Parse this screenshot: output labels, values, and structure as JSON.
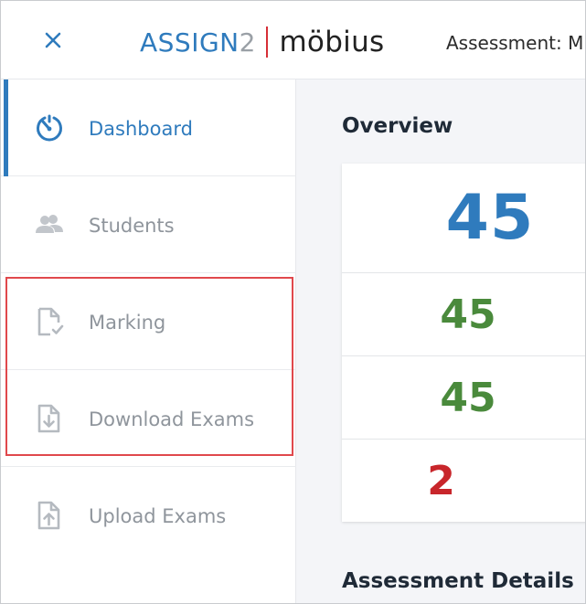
{
  "header": {
    "logo_assign": "ASSIGN",
    "logo_two": "2",
    "logo_mobius": "möbius",
    "assessment_label": "Assessment: M"
  },
  "sidebar": {
    "items": [
      {
        "label": "Dashboard",
        "icon": "timer-icon",
        "active": true
      },
      {
        "label": "Students",
        "icon": "people-icon",
        "active": false
      },
      {
        "label": "Marking",
        "icon": "file-check-icon",
        "active": false
      },
      {
        "label": "Download Exams",
        "icon": "file-download-icon",
        "active": false
      },
      {
        "label": "Upload Exams",
        "icon": "file-upload-icon",
        "active": false
      }
    ]
  },
  "main": {
    "overview_title": "Overview",
    "stats": [
      "45",
      "45",
      "45",
      "2"
    ],
    "details_title": "Assessment Details"
  },
  "colors": {
    "accent": "#2f7bbd",
    "green": "#4a8a3c",
    "red": "#c8262b",
    "highlight": "#e0484c"
  }
}
